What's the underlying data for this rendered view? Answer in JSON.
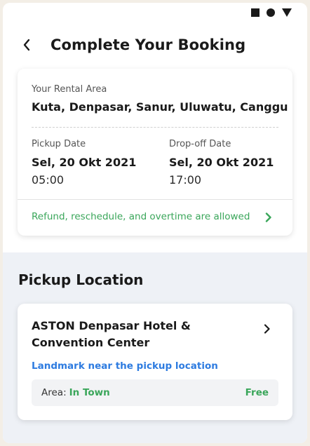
{
  "header": {
    "title": "Complete Your Booking"
  },
  "rental": {
    "area_label": "Your Rental Area",
    "area_value": "Kuta, Denpasar, Sanur, Uluwatu, Canggu",
    "pickup_label": "Pickup Date",
    "pickup_date": "Sel, 20 Okt 2021",
    "pickup_time": "05:00",
    "dropoff_label": "Drop-off Date",
    "dropoff_date": "Sel, 20 Okt 2021",
    "dropoff_time": "17:00",
    "policy_text": "Refund, reschedule, and overtime are allowed"
  },
  "pickup_location": {
    "section_title": "Pickup Location",
    "hotel_name": "ASTON Denpasar Hotel & Convention Center",
    "landmark_link": "Landmark near the pickup location",
    "area_label": "Area:",
    "area_value": "In Town",
    "price": "Free"
  },
  "colors": {
    "accent_green": "#3aa65a",
    "link_blue": "#2d7be0",
    "section_bg": "#eef1f6"
  }
}
